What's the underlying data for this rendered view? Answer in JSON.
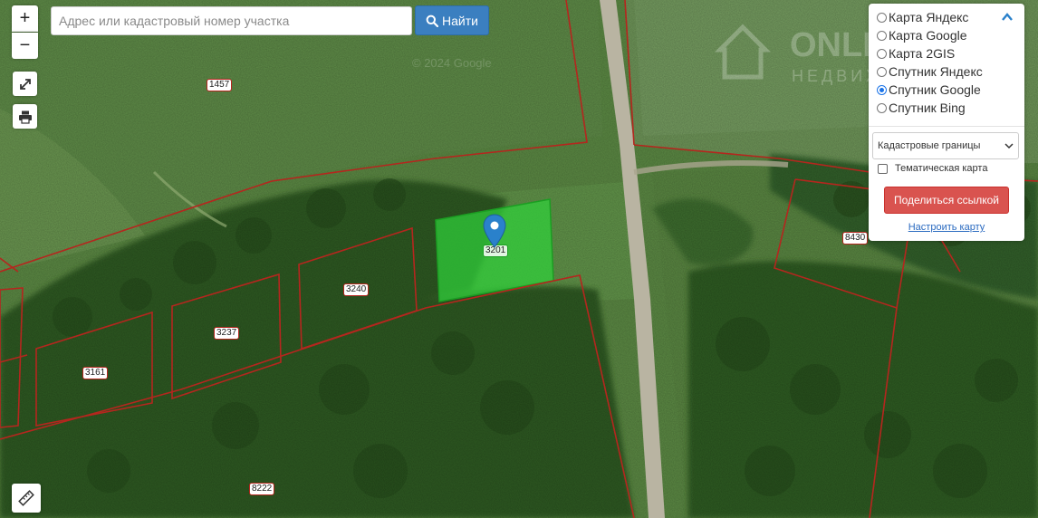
{
  "search": {
    "placeholder": "Адрес или кадастровый номер участка",
    "button_label": "Найти"
  },
  "controls": {
    "zoom_in": "+",
    "zoom_out": "−"
  },
  "layers": [
    {
      "label": "Карта Яндекс",
      "selected": false
    },
    {
      "label": "Карта Google",
      "selected": false
    },
    {
      "label": "Карта 2GIS",
      "selected": false
    },
    {
      "label": "Спутник Яндекс",
      "selected": false
    },
    {
      "label": "Спутник Google",
      "selected": true
    },
    {
      "label": "Спутник Bing",
      "selected": false
    }
  ],
  "overlay_select": {
    "value": "Кадастровые границы"
  },
  "thematic_map": {
    "label": "Тематическая карта",
    "checked": false
  },
  "share_button": "Поделиться ссылкой",
  "configure_link": "Настроить карту",
  "parcels": {
    "p1457": "1457",
    "p3240": "3240",
    "p3237": "3237",
    "p3161": "3161",
    "p8430": "8430",
    "p8222": "8222",
    "p3201": "3201"
  },
  "watermarks": {
    "brand": "ONLIGHT",
    "brand_sub": "НЕДВИЖИМОСТЬ",
    "imagery": "© 2024 Google"
  },
  "colors": {
    "boundary": "#b5261e",
    "selected_parcel": "#2fd13a",
    "marker": "#2a81cb",
    "search_button": "#3b7fc0",
    "share_button": "#d9534f"
  }
}
